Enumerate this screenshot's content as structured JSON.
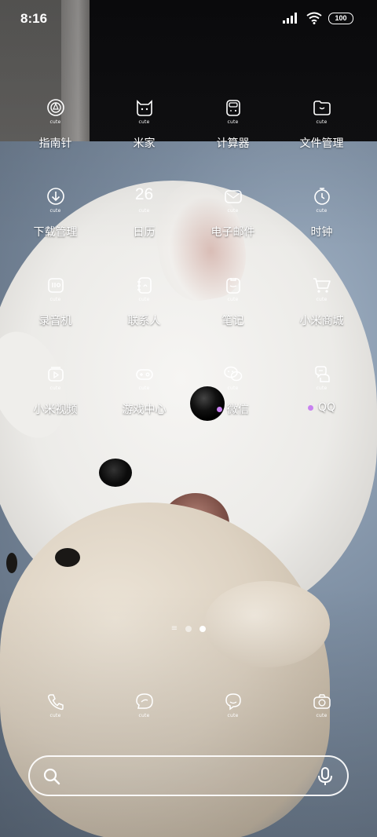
{
  "status_bar": {
    "time": "8:16",
    "battery": "100",
    "icons": [
      "signal-icon",
      "wifi-icon",
      "battery-icon"
    ]
  },
  "icon_badge_text": "cute",
  "apps": [
    {
      "label": "指南针",
      "icon": "compass-icon"
    },
    {
      "label": "米家",
      "icon": "mijia-icon"
    },
    {
      "label": "计算器",
      "icon": "calculator-icon"
    },
    {
      "label": "文件管理",
      "icon": "folder-icon"
    },
    {
      "label": "下载管理",
      "icon": "download-icon"
    },
    {
      "label": "日历",
      "icon": "calendar-icon",
      "date": "26"
    },
    {
      "label": "电子邮件",
      "icon": "mail-icon"
    },
    {
      "label": "时钟",
      "icon": "clock-icon"
    },
    {
      "label": "录音机",
      "icon": "recorder-icon"
    },
    {
      "label": "联系人",
      "icon": "contacts-icon"
    },
    {
      "label": "笔记",
      "icon": "notes-icon"
    },
    {
      "label": "小米商城",
      "icon": "cart-icon"
    },
    {
      "label": "小米视频",
      "icon": "video-icon"
    },
    {
      "label": "游戏中心",
      "icon": "gamepad-icon"
    },
    {
      "label": "微信",
      "icon": "wechat-icon",
      "new_dot": true
    },
    {
      "label": "QQ",
      "icon": "qq-icon",
      "new_dot": true
    }
  ],
  "page_indicator": {
    "pages": 2,
    "active": 2
  },
  "dock": [
    {
      "icon": "phone-icon"
    },
    {
      "icon": "message-icon"
    },
    {
      "icon": "browser-icon"
    },
    {
      "icon": "camera-icon"
    }
  ],
  "search_bar": {
    "icons": [
      "search-icon",
      "microphone-icon"
    ]
  },
  "colors": {
    "new_dot": "#c882f0",
    "icon_stroke": "#ffffff"
  }
}
